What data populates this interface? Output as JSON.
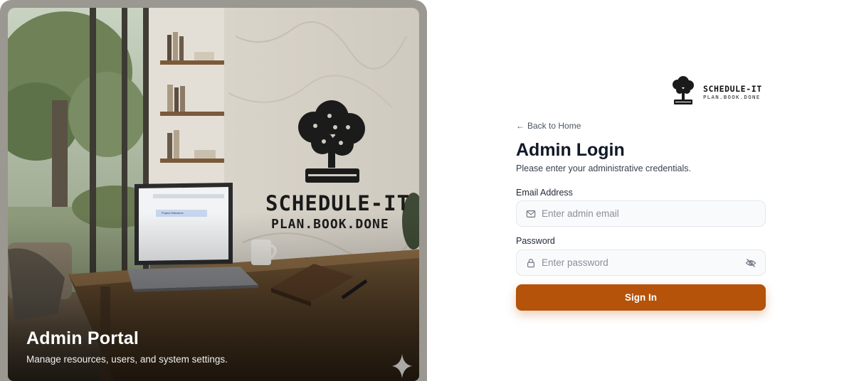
{
  "hero": {
    "title": "Admin Portal",
    "subtitle": "Manage resources, users, and system settings.",
    "wall_brand": "SCHEDULE-IT",
    "wall_tagline": "PLAN.BOOK.DONE",
    "laptop_card": "Project Milestone",
    "icons": [
      "tree-book-logo",
      "sparkle-icon"
    ]
  },
  "brand": {
    "name": "SCHEDULE-IT",
    "tagline": "PLAN.BOOK.DONE"
  },
  "back_link": {
    "arrow": "←",
    "label": "Back to Home"
  },
  "form": {
    "title": "Admin Login",
    "subtitle": "Please enter your administrative credentials.",
    "email_label": "Email Address",
    "email_placeholder": "Enter admin email",
    "email_value": "",
    "password_label": "Password",
    "password_placeholder": "Enter password",
    "password_value": "",
    "submit_label": "Sign In",
    "icons": [
      "mail-icon",
      "lock-icon",
      "eye-off-icon"
    ]
  },
  "colors": {
    "accent": "#b45309",
    "input_bg": "#f9fafb",
    "input_border": "#e5e7eb",
    "heading": "#111827"
  }
}
